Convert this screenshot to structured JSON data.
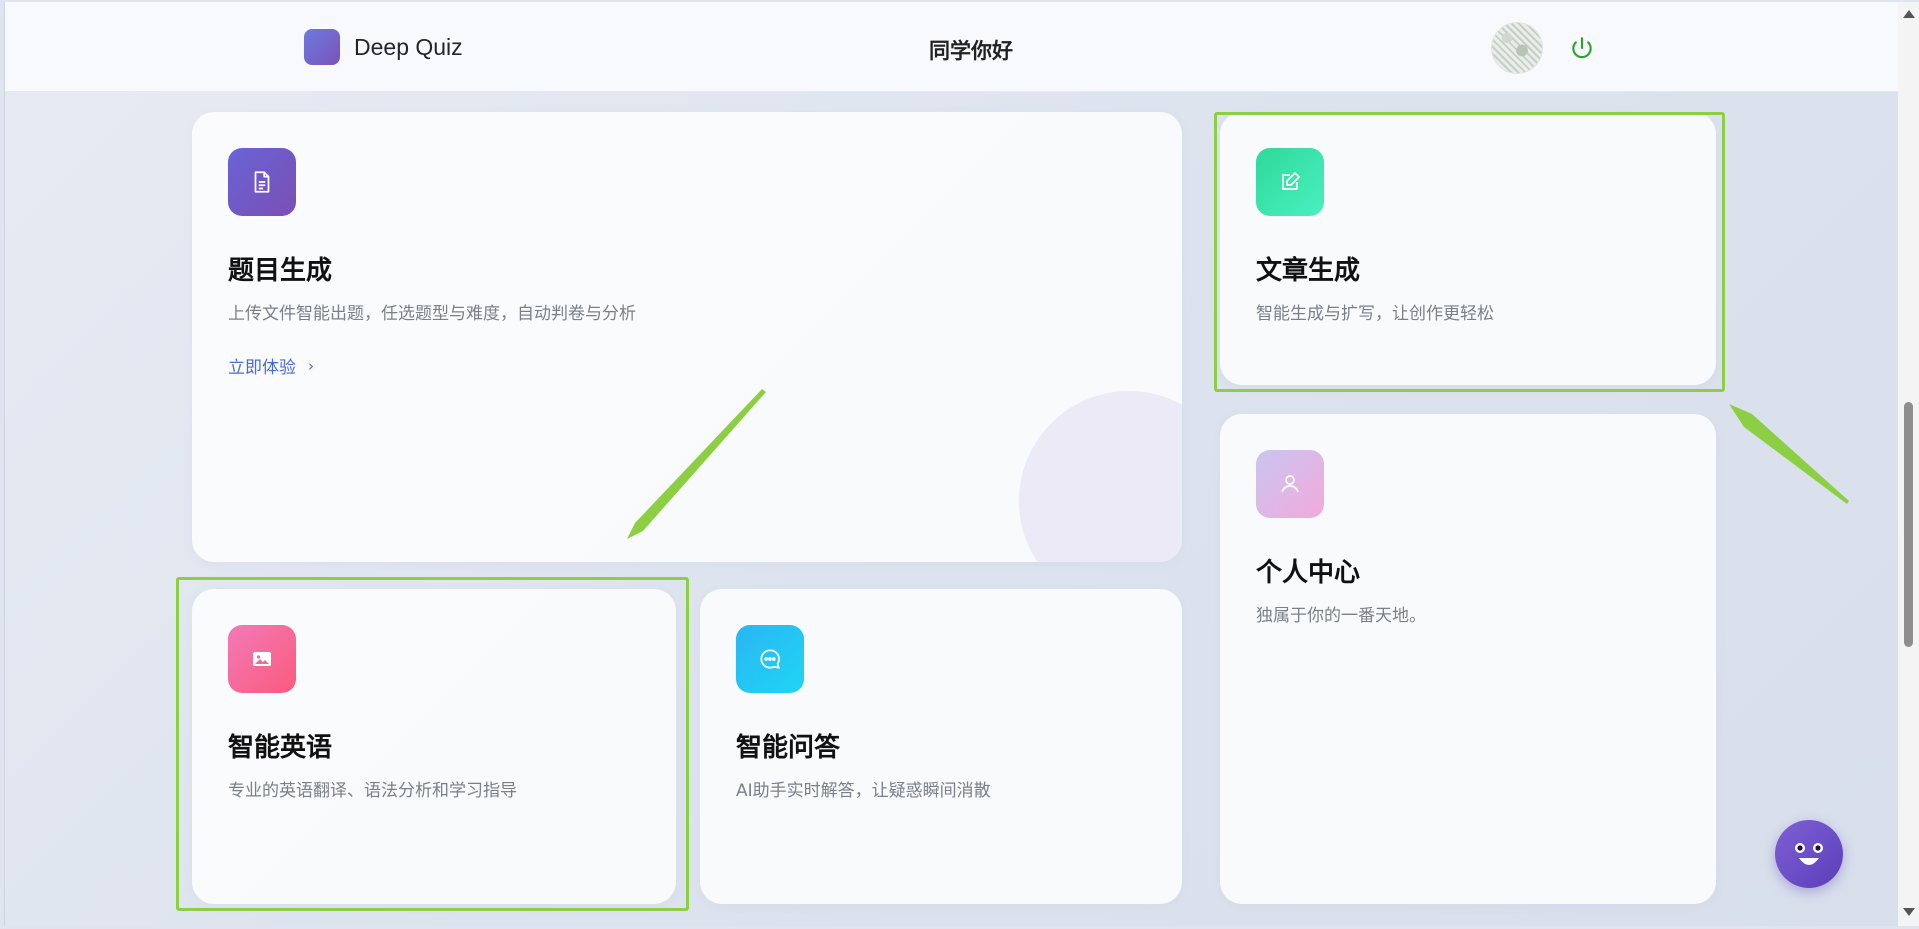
{
  "header": {
    "brand_name": "Deep Quiz",
    "greeting": "同学你好",
    "icons": {
      "brand": "brand-logo",
      "avatar": "user-avatar",
      "power": "power-icon"
    },
    "colors": {
      "power": "#2aa52a",
      "brand_from": "#6c7be0",
      "brand_to": "#7b52b8"
    }
  },
  "cards": {
    "quiz": {
      "title": "题目生成",
      "desc": "上传文件智能出题，任选题型与难度，自动判卷与分析",
      "cta": "立即体验",
      "icon": "document-icon",
      "color": "#6a5bc9"
    },
    "article": {
      "title": "文章生成",
      "desc": "智能生成与扩写，让创作更轻松",
      "icon": "edit-icon",
      "color": "#34e0a4"
    },
    "profile": {
      "title": "个人中心",
      "desc": "独属于你的一番天地。",
      "icon": "user-icon",
      "color": "#e9b3e6"
    },
    "english": {
      "title": "智能英语",
      "desc": "专业的英语翻译、语法分析和学习指导",
      "icon": "image-icon",
      "color": "#f5679a"
    },
    "qa": {
      "title": "智能问答",
      "desc": "AI助手实时解答，让疑惑瞬间消散",
      "icon": "chat-icon",
      "color": "#29c3f4"
    }
  },
  "annotations": {
    "highlight_color": "#8ccf43"
  },
  "floating": {
    "icon": "chat-bot-icon",
    "color": "#6a4cc6"
  }
}
